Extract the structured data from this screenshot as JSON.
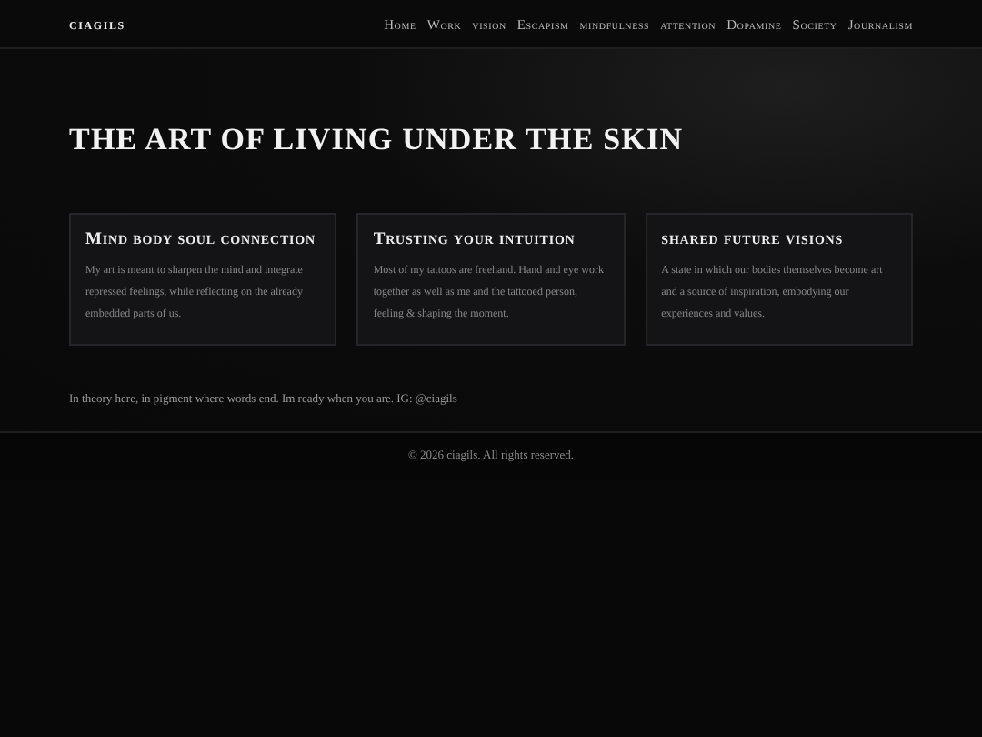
{
  "header": {
    "logo": "ciagils",
    "nav": [
      {
        "label": "Home"
      },
      {
        "label": "Work"
      },
      {
        "label": "vision"
      },
      {
        "label": "Escapism"
      },
      {
        "label": "mindfulness"
      },
      {
        "label": "attention"
      },
      {
        "label": "Dopamine"
      },
      {
        "label": "Society"
      },
      {
        "label": "Journalism"
      }
    ]
  },
  "hero": {
    "title": "THE ART OF LIVING UNDER THE SKIN"
  },
  "cards": [
    {
      "title": "Mind body soul connection",
      "text": "My art is meant to sharpen the mind and integrate repressed feelings, while reflecting on the already embedded parts of us."
    },
    {
      "title": "Trusting your intuition",
      "text": "Most of my tattoos are freehand. Hand and eye work together as well as me and the tattooed person, feeling & shaping the moment."
    },
    {
      "title": "shared future visions",
      "text": "A state in which our bodies themselves become art and a source of inspiration, embodying our experiences and values."
    }
  ],
  "note": "In theory here, in pigment where words end. Im ready when you are. IG: @ciagils",
  "footer": "© 2026 ciagils. All rights reserved."
}
